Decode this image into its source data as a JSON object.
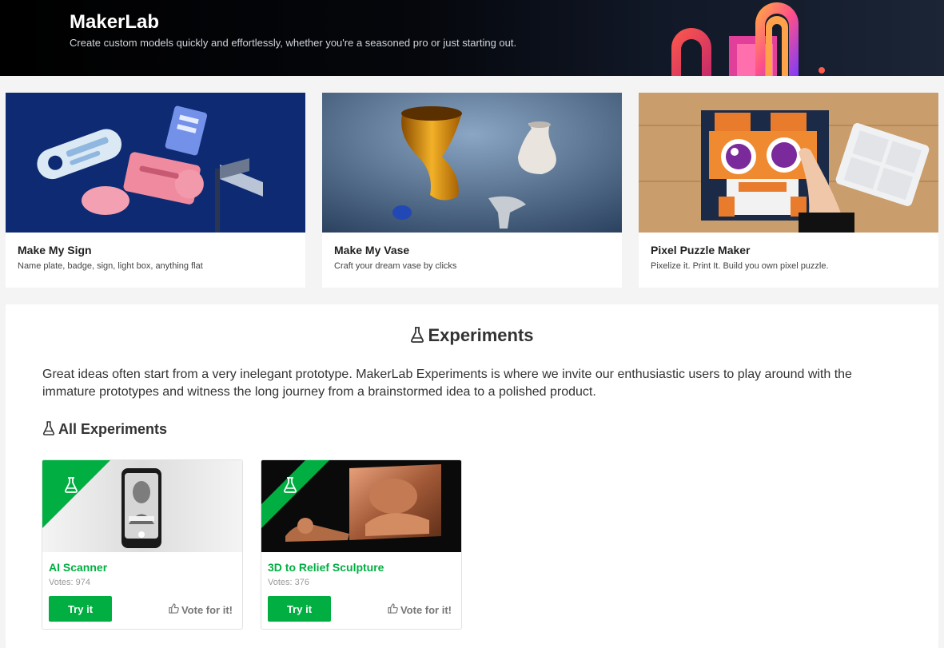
{
  "header": {
    "title": "MakerLab",
    "subtitle": "Create custom models quickly and effortlessly, whether you're a seasoned pro or just starting out."
  },
  "tools": [
    {
      "title": "Make My Sign",
      "description": "Name plate, badge, sign, light box, anything flat"
    },
    {
      "title": "Make My Vase",
      "description": "Craft your dream vase by clicks"
    },
    {
      "title": "Pixel Puzzle Maker",
      "description": "Pixelize it. Print It. Build you own pixel puzzle."
    }
  ],
  "experiments": {
    "heading": "Experiments",
    "intro": "Great ideas often start from a very inelegant prototype. MakerLab Experiments is where we invite our enthusiastic users to play around with the immature prototypes and witness the long journey from a brainstormed idea to a polished product.",
    "all_heading": "All Experiments",
    "items": [
      {
        "name": "AI Scanner",
        "votes": "Votes: 974",
        "try_label": "Try it",
        "vote_label": "Vote for it!"
      },
      {
        "name": "3D to Relief Sculpture",
        "votes": "Votes: 376",
        "try_label": "Try it",
        "vote_label": "Vote for it!"
      }
    ]
  },
  "colors": {
    "accent": "#00ae42",
    "banner_bg": "#000000",
    "page_bg": "#f4f4f4"
  },
  "icons": [
    "flask-icon",
    "thumbs-up-icon"
  ]
}
